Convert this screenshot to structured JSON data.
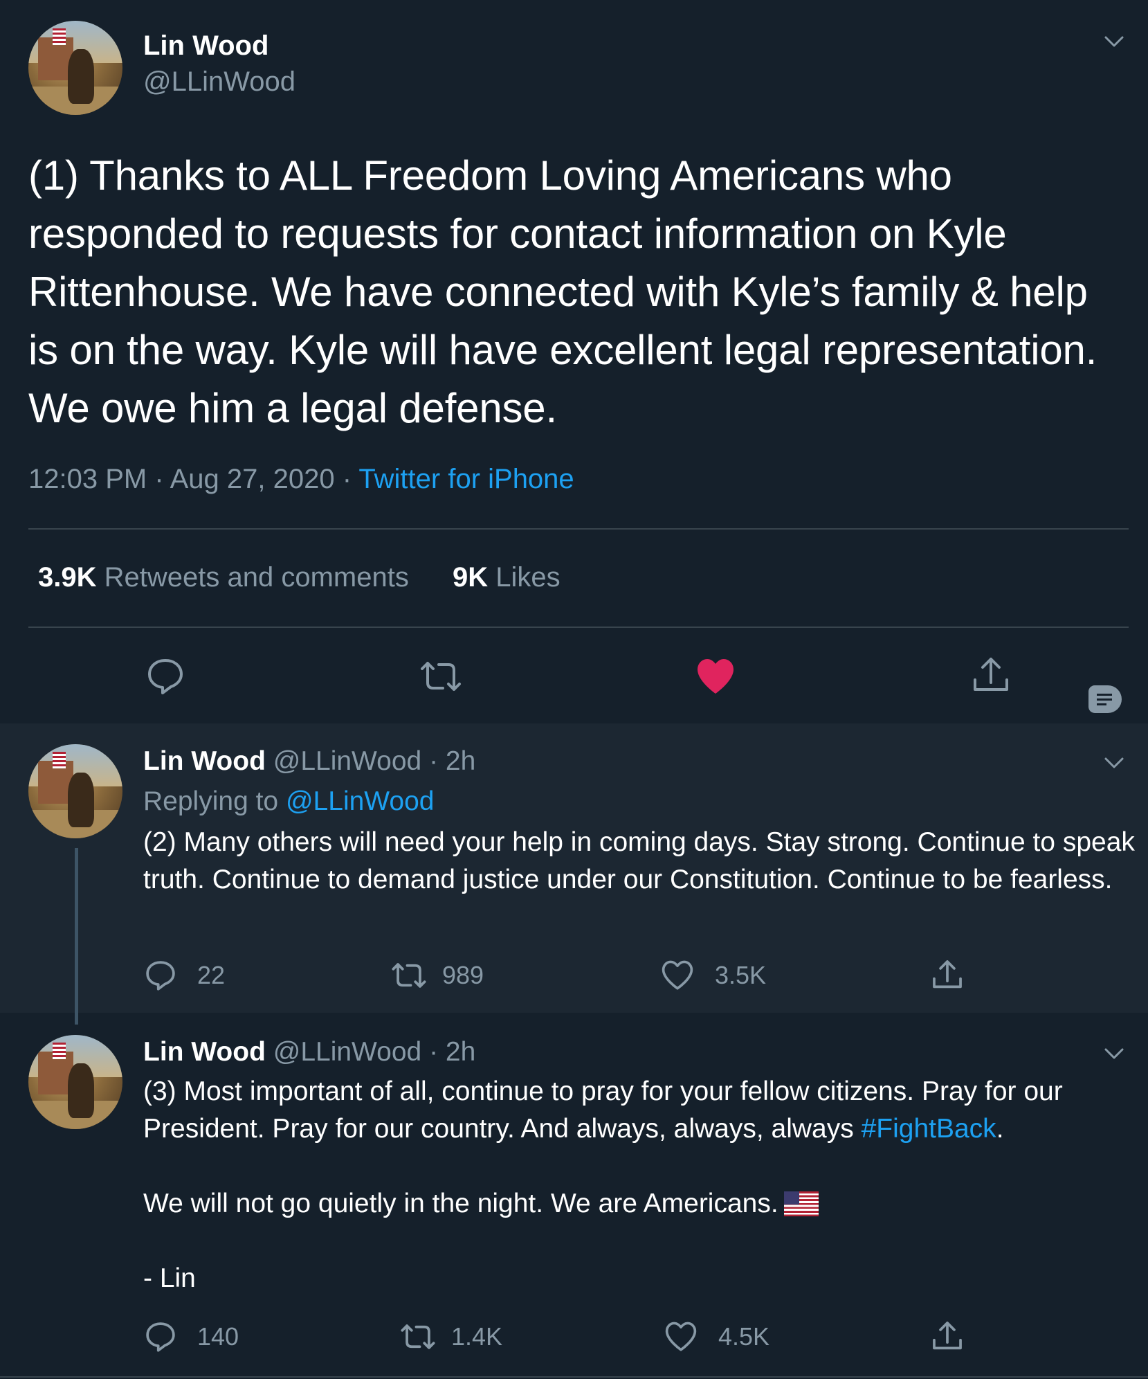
{
  "main_tweet": {
    "name": "Lin Wood",
    "handle": "@LLinWood",
    "text": "(1) Thanks to ALL Freedom Loving Americans who responded to requests for contact information on Kyle Rittenhouse. We have connected with Kyle’s family & help is on the way. Kyle will have excellent legal representation. We owe him a legal defense.",
    "time": "12:03 PM",
    "date": "Aug 27, 2020",
    "source": "Twitter for iPhone",
    "retweets_count": "3.9K",
    "retweets_label": "Retweets and comments",
    "likes_count": "9K",
    "likes_label": "Likes"
  },
  "replies": [
    {
      "name": "Lin Wood",
      "handle": "@LLinWood",
      "age": "2h",
      "replying_prefix": "Replying to",
      "replying_to": "@LLinWood",
      "text": "(2) Many others will need your help in coming days. Stay strong. Continue to speak truth. Continue to demand justice under our Constitution. Continue to be fearless.",
      "comments": "22",
      "retweets": "989",
      "likes": "3.5K"
    },
    {
      "name": "Lin Wood",
      "handle": "@LLinWood",
      "age": "2h",
      "text_line1": "(3) Most important of all, continue to pray for your fellow citizens. Pray for our President. Pray for our country. And always, always, always",
      "hashtag": "#FightBack",
      "text_end": ".",
      "text_line2": "We will not go quietly in the night. We are Americans.",
      "text_line3": "- Lin",
      "comments": "140",
      "retweets": "1.4K",
      "likes": "4.5K"
    }
  ],
  "separator": "·",
  "colors": {
    "background": "#15202b",
    "reply_background": "#1c2732",
    "secondary_text": "#8899a6",
    "link": "#1da1f2",
    "like_active": "#e0245e",
    "divider": "#38444d"
  },
  "icons": [
    "chevron-down-icon",
    "comment-icon",
    "retweet-icon",
    "heart-icon",
    "share-icon",
    "flag-us-icon"
  ]
}
